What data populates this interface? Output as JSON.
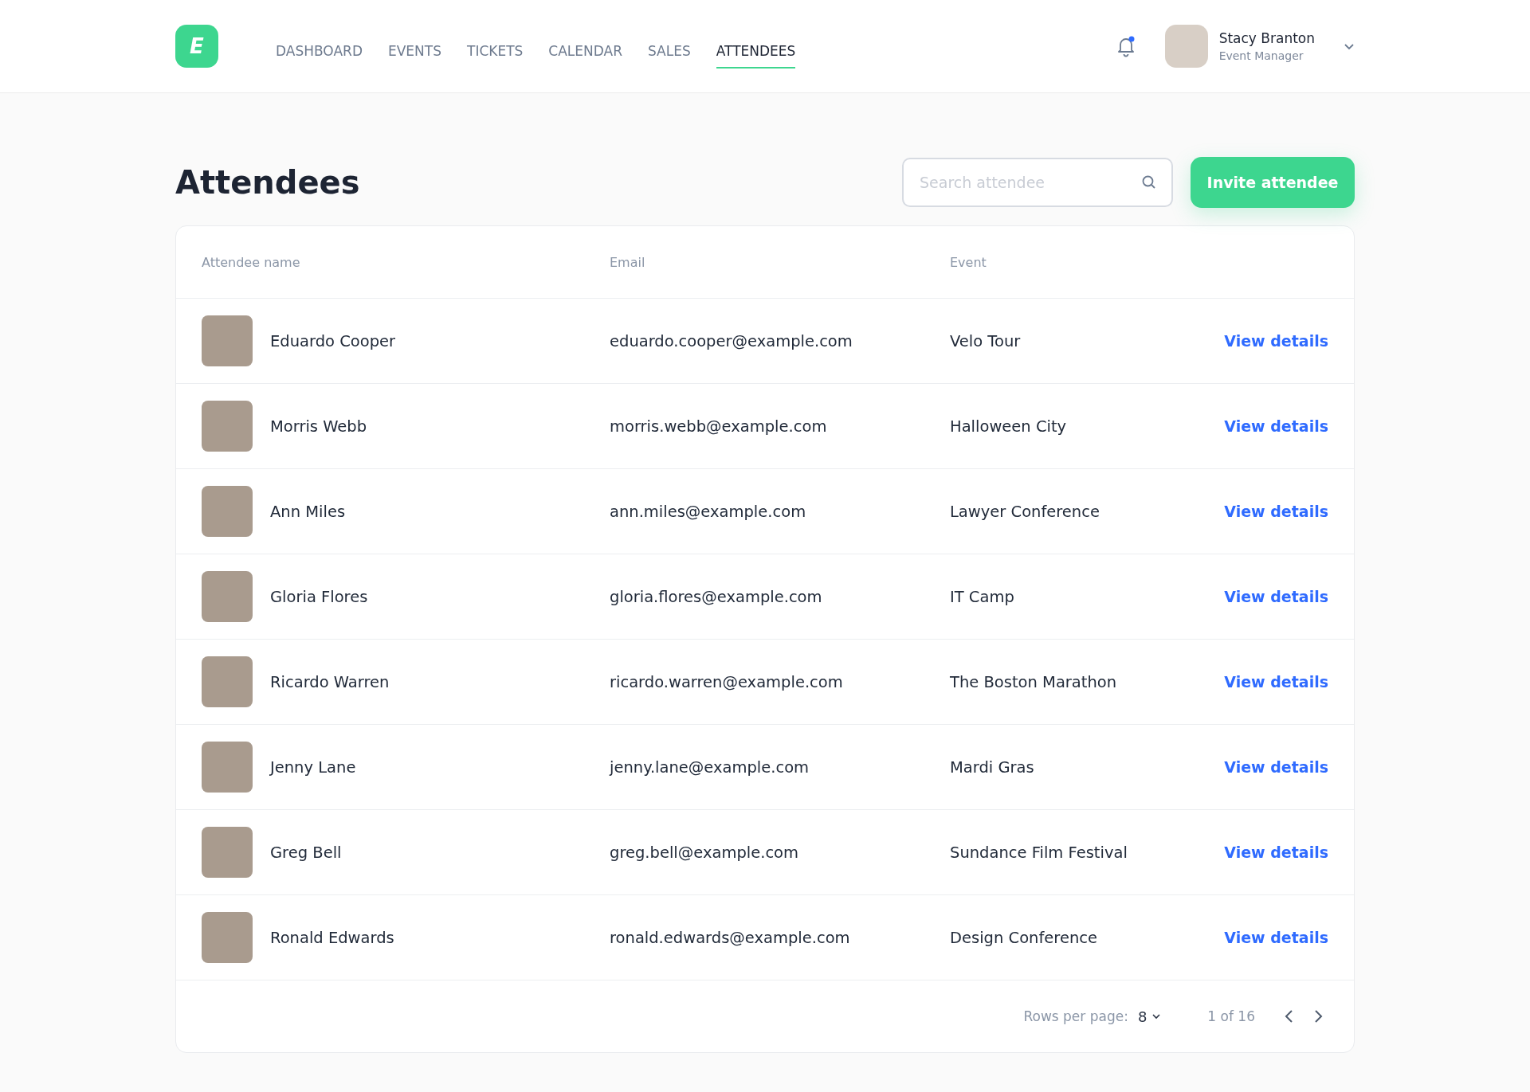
{
  "logo": {
    "letter": "E"
  },
  "nav": [
    {
      "label": "DASHBOARD",
      "selected": false
    },
    {
      "label": "EVENTS",
      "selected": false
    },
    {
      "label": "TICKETS",
      "selected": false
    },
    {
      "label": "CALENDAR",
      "selected": false
    },
    {
      "label": "SALES",
      "selected": false
    },
    {
      "label": "ATTENDEES",
      "selected": true
    }
  ],
  "user": {
    "name": "Stacy Branton",
    "role": "Event Manager"
  },
  "page": {
    "title": "Attendees",
    "search": {
      "placeholder": "Search attendee"
    },
    "invite_button": "Invite attendee"
  },
  "table": {
    "columns": [
      "Attendee name",
      "Email",
      "Event"
    ],
    "rows": [
      {
        "name": "Eduardo Cooper",
        "email": "eduardo.cooper@example.com",
        "event": "Velo Tour",
        "action": "View details"
      },
      {
        "name": "Morris Webb",
        "email": "morris.webb@example.com",
        "event": "Halloween City",
        "action": "View details"
      },
      {
        "name": "Ann Miles",
        "email": "ann.miles@example.com",
        "event": "Lawyer Conference",
        "action": "View details"
      },
      {
        "name": "Gloria Flores",
        "email": "gloria.flores@example.com",
        "event": "IT Camp",
        "action": "View details"
      },
      {
        "name": "Ricardo Warren",
        "email": "ricardo.warren@example.com",
        "event": "The Boston Marathon",
        "action": "View details"
      },
      {
        "name": "Jenny Lane",
        "email": "jenny.lane@example.com",
        "event": "Mardi Gras",
        "action": "View details"
      },
      {
        "name": "Greg Bell",
        "email": "greg.bell@example.com",
        "event": "Sundance Film Festival",
        "action": "View details"
      },
      {
        "name": "Ronald Edwards",
        "email": "ronald.edwards@example.com",
        "event": "Design Conference",
        "action": "View details"
      }
    ]
  },
  "pagination": {
    "rows_per_page_label": "Rows per page:",
    "rows_per_page": "8",
    "range": "1 of 16"
  }
}
